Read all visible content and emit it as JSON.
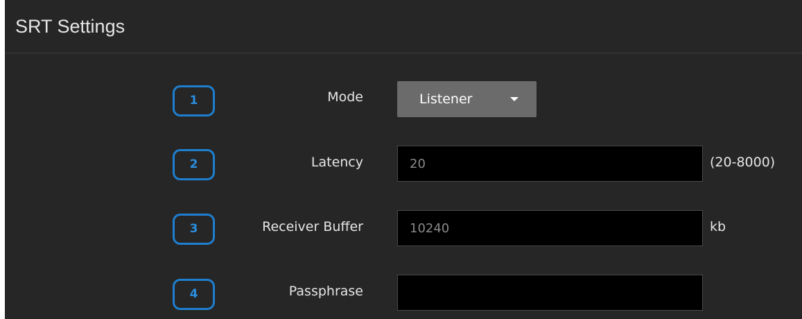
{
  "panel": {
    "title": "SRT Settings"
  },
  "rows": [
    {
      "badge": "1",
      "label": "Mode",
      "dropdown_value": "Listener"
    },
    {
      "badge": "2",
      "label": "Latency",
      "value": "20",
      "suffix": "(20-8000)"
    },
    {
      "badge": "3",
      "label": "Receiver Buffer",
      "value": "10240",
      "suffix": "kb"
    },
    {
      "badge": "4",
      "label": "Passphrase",
      "value": ""
    }
  ],
  "colors": {
    "panel_background": "#262626",
    "badge_accent": "#1e7fd0",
    "dropdown_background": "#6b6b6b",
    "input_background": "#000000"
  },
  "icons": {
    "dropdown": "caret-down-icon"
  }
}
